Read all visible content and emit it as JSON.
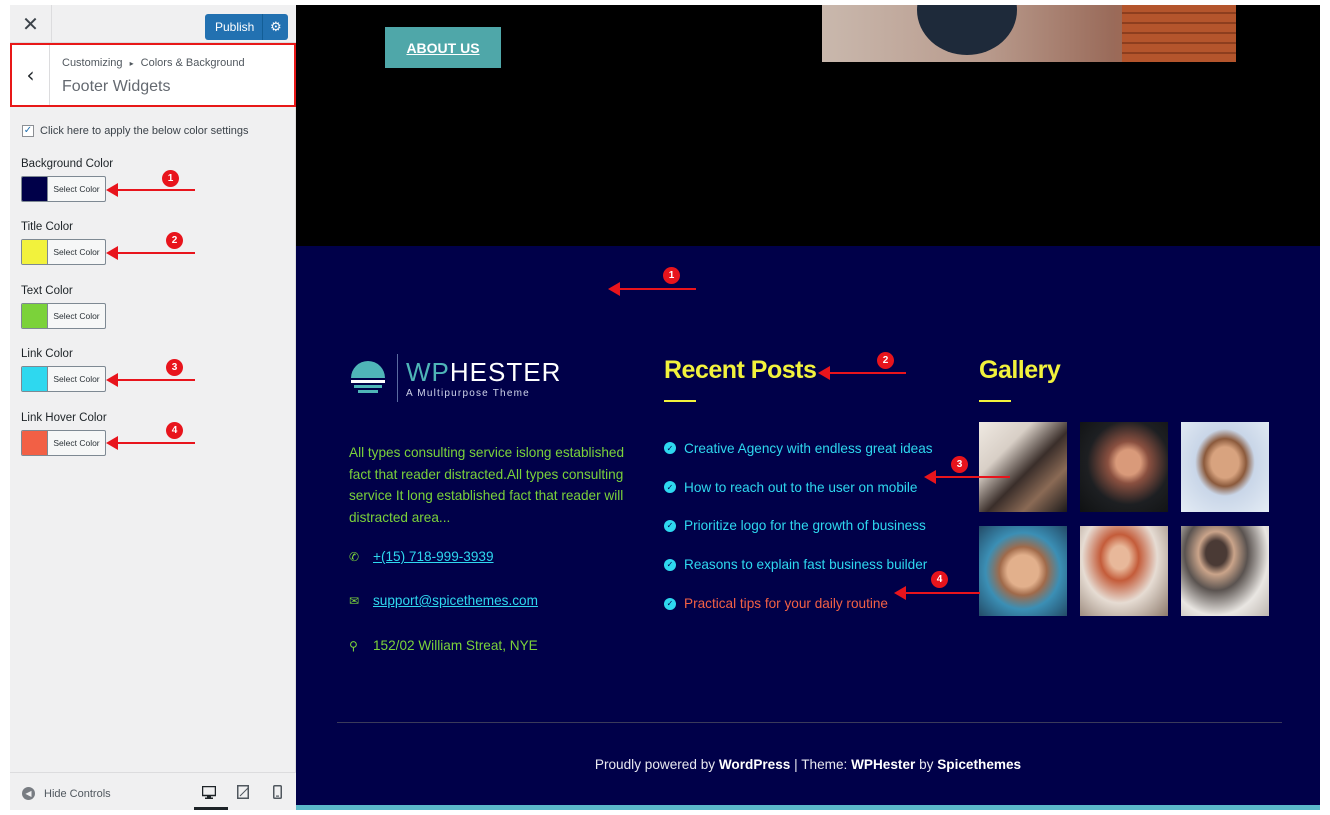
{
  "customizer": {
    "close_icon": "close-icon",
    "publish_label": "Publish",
    "breadcrumb_root": "Customizing",
    "breadcrumb_separator": "▸",
    "breadcrumb_section": "Colors & Background",
    "panel_title": "Footer Widgets",
    "apply_label": "Click here to apply the below color settings",
    "apply_checked": true,
    "color_settings": [
      {
        "label": "Background Color",
        "button": "Select Color",
        "color": "#000049",
        "marker": "1"
      },
      {
        "label": "Title Color",
        "button": "Select Color",
        "color": "#f2f23c",
        "marker": "2"
      },
      {
        "label": "Text Color",
        "button": "Select Color",
        "color": "#7bd23a",
        "marker": ""
      },
      {
        "label": "Link Color",
        "button": "Select Color",
        "color": "#2ed8ef",
        "marker": "3"
      },
      {
        "label": "Link Hover Color",
        "button": "Select Color",
        "color": "#f26045",
        "marker": "4"
      }
    ],
    "hide_controls": "Hide Controls",
    "devices": [
      "desktop",
      "tablet",
      "mobile"
    ]
  },
  "preview": {
    "about_button": "ABOUT US",
    "logo": {
      "name_prefix": "WP",
      "name_rest": "HESTER",
      "tagline": "A Multipurpose Theme"
    },
    "about_text": "All types consulting service islong established fact that reader distracted.All types consulting service It long established fact that reader will distracted area...",
    "phone": "+(15) 718-999-3939",
    "email": "support@spicethemes.com",
    "address": "152/02 William Streat, NYE",
    "recent_posts_title": "Recent Posts",
    "recent_posts": [
      "Creative Agency with endless great ideas",
      "How to reach out to the user on mobile",
      "Prioritize logo for the growth of business",
      "Reasons to explain fast business builder",
      "Practical tips for your daily routine"
    ],
    "gallery_title": "Gallery",
    "copyright": {
      "prefix": "Proudly powered by ",
      "wordpress": "WordPress",
      "sep": " | Theme: ",
      "theme": "WPHester",
      "by": " by ",
      "author": "Spicethemes"
    }
  },
  "annotations": {
    "markers": [
      "1",
      "2",
      "3",
      "4"
    ]
  },
  "colors": {
    "footer_bg": "#000049",
    "hero_bg": "#000000",
    "title": "#f2f23c",
    "text": "#7bd23a",
    "link": "#2ed8ef",
    "link_hover": "#f26045",
    "accent": "#2271b1",
    "annotation": "#e8141c"
  }
}
